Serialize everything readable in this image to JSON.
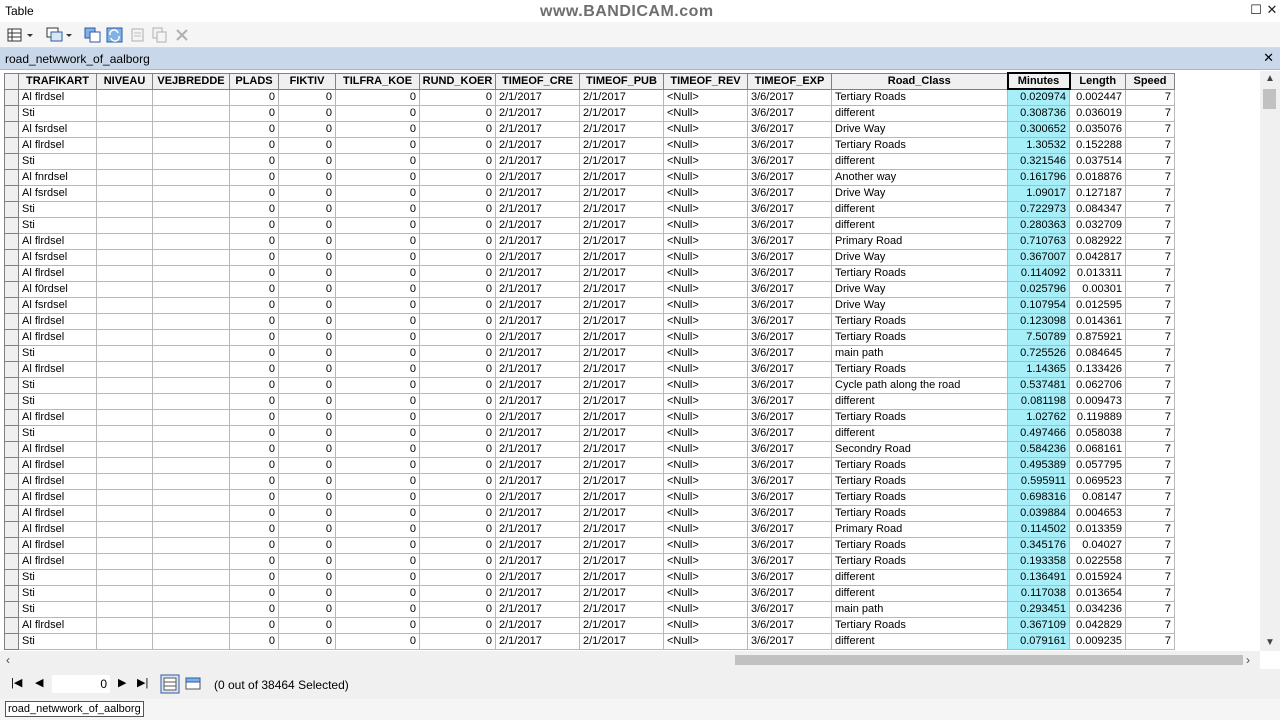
{
  "window": {
    "title": "Table"
  },
  "watermark": "www.BANDICAM.com",
  "tab": {
    "name": "road_netwwork_of_aalborg"
  },
  "columns": [
    "TRAFIKART",
    "NIVEAU",
    "VEJBREDDE",
    "PLADS",
    "FIKTIV",
    "TILFRA_KOE",
    "RUND_KOER",
    "TIMEOF_CRE",
    "TIMEOF_PUB",
    "TIMEOF_REV",
    "TIMEOF_EXP",
    "Road_Class",
    "Minutes",
    "Length",
    "Speed"
  ],
  "rows": [
    [
      "Al flrdsel",
      "",
      "",
      "0",
      "0",
      "0",
      "0",
      "2/1/2017",
      "2/1/2017",
      "<Null>",
      "3/6/2017",
      "Tertiary Roads",
      "0.020974",
      "0.002447",
      "7"
    ],
    [
      "Sti",
      "",
      "",
      "0",
      "0",
      "0",
      "0",
      "2/1/2017",
      "2/1/2017",
      "<Null>",
      "3/6/2017",
      "different",
      "0.308736",
      "0.036019",
      "7"
    ],
    [
      "Al fsrdsel",
      "",
      "",
      "0",
      "0",
      "0",
      "0",
      "2/1/2017",
      "2/1/2017",
      "<Null>",
      "3/6/2017",
      "Drive Way",
      "0.300652",
      "0.035076",
      "7"
    ],
    [
      "Al flrdsel",
      "",
      "",
      "0",
      "0",
      "0",
      "0",
      "2/1/2017",
      "2/1/2017",
      "<Null>",
      "3/6/2017",
      "Tertiary Roads",
      "1.30532",
      "0.152288",
      "7"
    ],
    [
      "Sti",
      "",
      "",
      "0",
      "0",
      "0",
      "0",
      "2/1/2017",
      "2/1/2017",
      "<Null>",
      "3/6/2017",
      "different",
      "0.321546",
      "0.037514",
      "7"
    ],
    [
      "Al fnrdsel",
      "",
      "",
      "0",
      "0",
      "0",
      "0",
      "2/1/2017",
      "2/1/2017",
      "<Null>",
      "3/6/2017",
      "Another way",
      "0.161796",
      "0.018876",
      "7"
    ],
    [
      "Al fsrdsel",
      "",
      "",
      "0",
      "0",
      "0",
      "0",
      "2/1/2017",
      "2/1/2017",
      "<Null>",
      "3/6/2017",
      "Drive Way",
      "1.09017",
      "0.127187",
      "7"
    ],
    [
      "Sti",
      "",
      "",
      "0",
      "0",
      "0",
      "0",
      "2/1/2017",
      "2/1/2017",
      "<Null>",
      "3/6/2017",
      "different",
      "0.722973",
      "0.084347",
      "7"
    ],
    [
      "Sti",
      "",
      "",
      "0",
      "0",
      "0",
      "0",
      "2/1/2017",
      "2/1/2017",
      "<Null>",
      "3/6/2017",
      "different",
      "0.280363",
      "0.032709",
      "7"
    ],
    [
      "Al flrdsel",
      "",
      "",
      "0",
      "0",
      "0",
      "0",
      "2/1/2017",
      "2/1/2017",
      "<Null>",
      "3/6/2017",
      "Primary Road",
      "0.710763",
      "0.082922",
      "7"
    ],
    [
      "Al fsrdsel",
      "",
      "",
      "0",
      "0",
      "0",
      "0",
      "2/1/2017",
      "2/1/2017",
      "<Null>",
      "3/6/2017",
      "Drive Way",
      "0.367007",
      "0.042817",
      "7"
    ],
    [
      "Al flrdsel",
      "",
      "",
      "0",
      "0",
      "0",
      "0",
      "2/1/2017",
      "2/1/2017",
      "<Null>",
      "3/6/2017",
      "Tertiary Roads",
      "0.114092",
      "0.013311",
      "7"
    ],
    [
      "Al f0rdsel",
      "",
      "",
      "0",
      "0",
      "0",
      "0",
      "2/1/2017",
      "2/1/2017",
      "<Null>",
      "3/6/2017",
      "Drive Way",
      "0.025796",
      "0.00301",
      "7"
    ],
    [
      "Al fsrdsel",
      "",
      "",
      "0",
      "0",
      "0",
      "0",
      "2/1/2017",
      "2/1/2017",
      "<Null>",
      "3/6/2017",
      "Drive Way",
      "0.107954",
      "0.012595",
      "7"
    ],
    [
      "Al flrdsel",
      "",
      "",
      "0",
      "0",
      "0",
      "0",
      "2/1/2017",
      "2/1/2017",
      "<Null>",
      "3/6/2017",
      "Tertiary Roads",
      "0.123098",
      "0.014361",
      "7"
    ],
    [
      "Al flrdsel",
      "",
      "",
      "0",
      "0",
      "0",
      "0",
      "2/1/2017",
      "2/1/2017",
      "<Null>",
      "3/6/2017",
      "Tertiary Roads",
      "7.50789",
      "0.875921",
      "7"
    ],
    [
      "Sti",
      "",
      "",
      "0",
      "0",
      "0",
      "0",
      "2/1/2017",
      "2/1/2017",
      "<Null>",
      "3/6/2017",
      "main path",
      "0.725526",
      "0.084645",
      "7"
    ],
    [
      "Al flrdsel",
      "",
      "",
      "0",
      "0",
      "0",
      "0",
      "2/1/2017",
      "2/1/2017",
      "<Null>",
      "3/6/2017",
      "Tertiary Roads",
      "1.14365",
      "0.133426",
      "7"
    ],
    [
      "Sti",
      "",
      "",
      "0",
      "0",
      "0",
      "0",
      "2/1/2017",
      "2/1/2017",
      "<Null>",
      "3/6/2017",
      "Cycle path along the road",
      "0.537481",
      "0.062706",
      "7"
    ],
    [
      "Sti",
      "",
      "",
      "0",
      "0",
      "0",
      "0",
      "2/1/2017",
      "2/1/2017",
      "<Null>",
      "3/6/2017",
      "different",
      "0.081198",
      "0.009473",
      "7"
    ],
    [
      "Al flrdsel",
      "",
      "",
      "0",
      "0",
      "0",
      "0",
      "2/1/2017",
      "2/1/2017",
      "<Null>",
      "3/6/2017",
      "Tertiary Roads",
      "1.02762",
      "0.119889",
      "7"
    ],
    [
      "Sti",
      "",
      "",
      "0",
      "0",
      "0",
      "0",
      "2/1/2017",
      "2/1/2017",
      "<Null>",
      "3/6/2017",
      "different",
      "0.497466",
      "0.058038",
      "7"
    ],
    [
      "Al flrdsel",
      "",
      "",
      "0",
      "0",
      "0",
      "0",
      "2/1/2017",
      "2/1/2017",
      "<Null>",
      "3/6/2017",
      "Secondry Road",
      "0.584236",
      "0.068161",
      "7"
    ],
    [
      "Al flrdsel",
      "",
      "",
      "0",
      "0",
      "0",
      "0",
      "2/1/2017",
      "2/1/2017",
      "<Null>",
      "3/6/2017",
      "Tertiary Roads",
      "0.495389",
      "0.057795",
      "7"
    ],
    [
      "Al flrdsel",
      "",
      "",
      "0",
      "0",
      "0",
      "0",
      "2/1/2017",
      "2/1/2017",
      "<Null>",
      "3/6/2017",
      "Tertiary Roads",
      "0.595911",
      "0.069523",
      "7"
    ],
    [
      "Al flrdsel",
      "",
      "",
      "0",
      "0",
      "0",
      "0",
      "2/1/2017",
      "2/1/2017",
      "<Null>",
      "3/6/2017",
      "Tertiary Roads",
      "0.698316",
      "0.08147",
      "7"
    ],
    [
      "Al flrdsel",
      "",
      "",
      "0",
      "0",
      "0",
      "0",
      "2/1/2017",
      "2/1/2017",
      "<Null>",
      "3/6/2017",
      "Tertiary Roads",
      "0.039884",
      "0.004653",
      "7"
    ],
    [
      "Al flrdsel",
      "",
      "",
      "0",
      "0",
      "0",
      "0",
      "2/1/2017",
      "2/1/2017",
      "<Null>",
      "3/6/2017",
      "Primary Road",
      "0.114502",
      "0.013359",
      "7"
    ],
    [
      "Al flrdsel",
      "",
      "",
      "0",
      "0",
      "0",
      "0",
      "2/1/2017",
      "2/1/2017",
      "<Null>",
      "3/6/2017",
      "Tertiary Roads",
      "0.345176",
      "0.04027",
      "7"
    ],
    [
      "Al flrdsel",
      "",
      "",
      "0",
      "0",
      "0",
      "0",
      "2/1/2017",
      "2/1/2017",
      "<Null>",
      "3/6/2017",
      "Tertiary Roads",
      "0.193358",
      "0.022558",
      "7"
    ],
    [
      "Sti",
      "",
      "",
      "0",
      "0",
      "0",
      "0",
      "2/1/2017",
      "2/1/2017",
      "<Null>",
      "3/6/2017",
      "different",
      "0.136491",
      "0.015924",
      "7"
    ],
    [
      "Sti",
      "",
      "",
      "0",
      "0",
      "0",
      "0",
      "2/1/2017",
      "2/1/2017",
      "<Null>",
      "3/6/2017",
      "different",
      "0.117038",
      "0.013654",
      "7"
    ],
    [
      "Sti",
      "",
      "",
      "0",
      "0",
      "0",
      "0",
      "2/1/2017",
      "2/1/2017",
      "<Null>",
      "3/6/2017",
      "main path",
      "0.293451",
      "0.034236",
      "7"
    ],
    [
      "Al flrdsel",
      "",
      "",
      "0",
      "0",
      "0",
      "0",
      "2/1/2017",
      "2/1/2017",
      "<Null>",
      "3/6/2017",
      "Tertiary Roads",
      "0.367109",
      "0.042829",
      "7"
    ],
    [
      "Sti",
      "",
      "",
      "0",
      "0",
      "0",
      "0",
      "2/1/2017",
      "2/1/2017",
      "<Null>",
      "3/6/2017",
      "different",
      "0.079161",
      "0.009235",
      "7"
    ]
  ],
  "navigation": {
    "current_record": "0",
    "status": "(0 out of 38464 Selected)"
  },
  "bottom_tab": {
    "name": "road_netwwork_of_aalborg"
  },
  "colors": {
    "tab_bar": "#c8d7ea",
    "selected_column": "#a6eef8",
    "header": "#f0f0f0"
  }
}
